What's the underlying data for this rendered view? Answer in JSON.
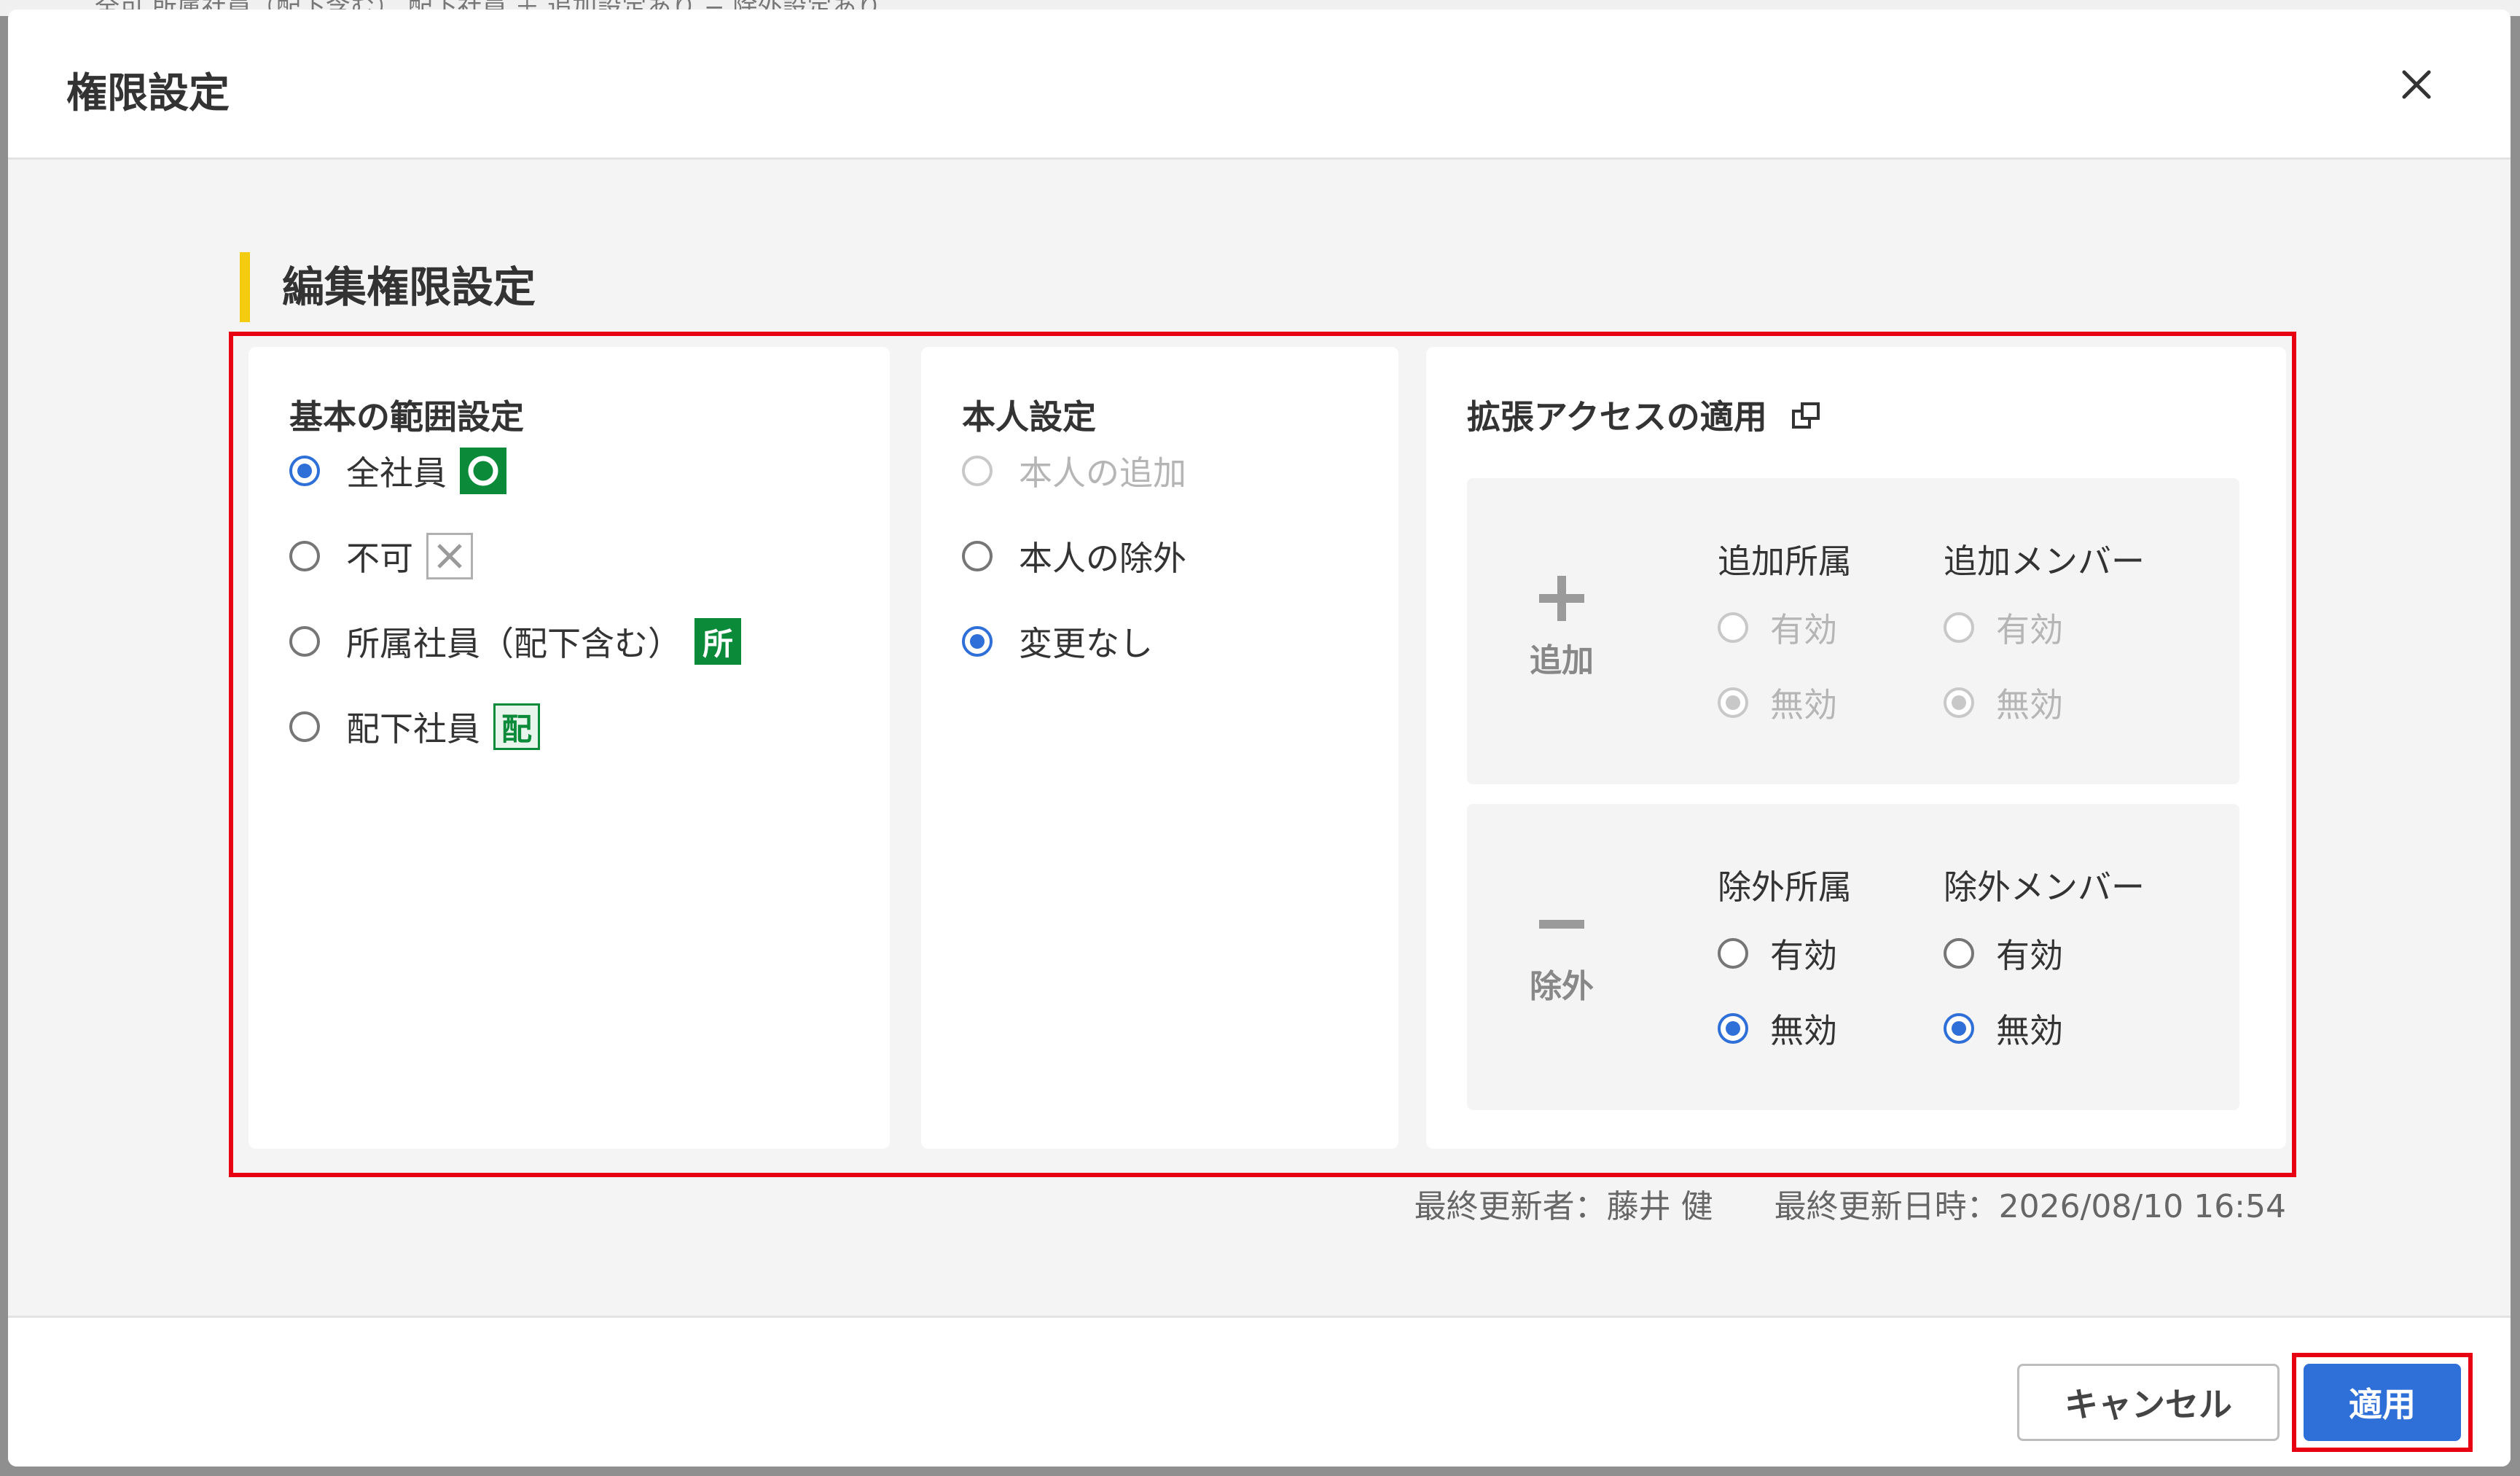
{
  "background": {
    "strip_text": "全可  所属社員（配下含む）  配下社員  ＋ 追加設定あり  − 除外設定あり"
  },
  "dialog": {
    "title": "権限設定",
    "close_icon": "close-icon"
  },
  "section": {
    "title": "編集権限設定"
  },
  "basic_range": {
    "title": "基本の範囲設定",
    "options": [
      {
        "label": "全社員",
        "checked": true,
        "badge": "",
        "badge_icon": "circle-icon"
      },
      {
        "label": "不可",
        "checked": false,
        "badge": "",
        "badge_icon": "cross-icon"
      },
      {
        "label": "所属社員（配下含む）",
        "checked": false,
        "badge": "所",
        "badge_icon": ""
      },
      {
        "label": "配下社員",
        "checked": false,
        "badge": "配",
        "badge_icon": ""
      }
    ]
  },
  "self_setting": {
    "title": "本人設定",
    "options": [
      {
        "label": "本人の追加",
        "checked": false,
        "disabled": true
      },
      {
        "label": "本人の除外",
        "checked": false,
        "disabled": false
      },
      {
        "label": "変更なし",
        "checked": true,
        "disabled": false
      }
    ]
  },
  "extended_access": {
    "title": "拡張アクセスの適用",
    "title_icon": "external-link-icon",
    "add": {
      "label": "追加",
      "icon": "plus-icon",
      "columns": [
        {
          "header": "追加所属",
          "enabled_label": "有効",
          "disabled_label": "無効",
          "selected": "無効",
          "disabled": true
        },
        {
          "header": "追加メンバー",
          "enabled_label": "有効",
          "disabled_label": "無効",
          "selected": "無効",
          "disabled": true
        }
      ]
    },
    "exclude": {
      "label": "除外",
      "icon": "minus-icon",
      "columns": [
        {
          "header": "除外所属",
          "enabled_label": "有効",
          "disabled_label": "無効",
          "selected": "無効",
          "disabled": false
        },
        {
          "header": "除外メンバー",
          "enabled_label": "有効",
          "disabled_label": "無効",
          "selected": "無効",
          "disabled": false
        }
      ]
    }
  },
  "meta": {
    "last_updated_by": "最終更新者：藤井 健",
    "last_updated_at": "最終更新日時：2026/08/10 16:54"
  },
  "footer": {
    "cancel_label": "キャンセル",
    "apply_label": "適用"
  },
  "colors": {
    "accent": "#2f6fd8",
    "highlight": "#e60012",
    "section_marker": "#f3cc10",
    "badge_green": "#0b8a3a"
  }
}
